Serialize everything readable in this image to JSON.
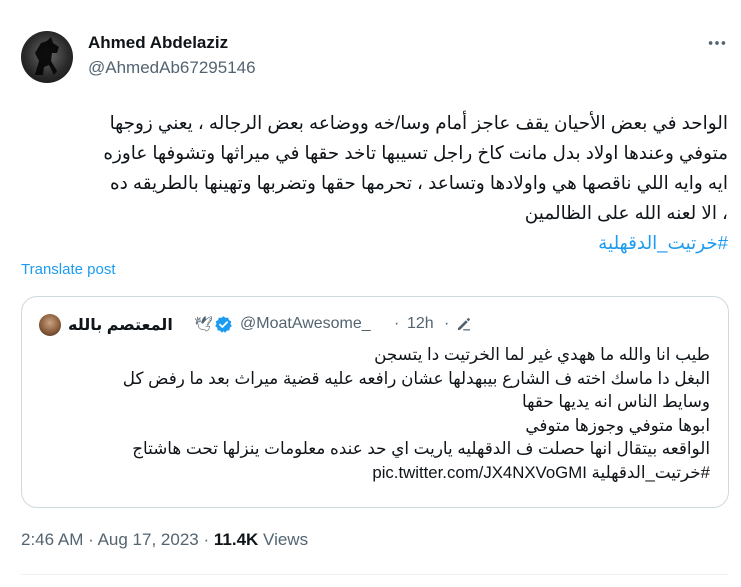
{
  "author": {
    "name": "Ahmed Abdelaziz",
    "handle": "@AhmedAb67295146"
  },
  "tweet": {
    "lines": [
      "الواحد في بعض الأحيان يقف عاجز أمام وسا/خه ووضاعه بعض الرجاله ، يعني زوجها",
      "متوفي وعندها اولاد بدل مانت كاخ راجل تسيبها تاخد حقها في ميراثها وتشوفها عاوزه",
      "ايه وايه اللي ناقصها هي واولادها وتساعد ، تحرمها حقها وتضربها وتهينها بالطريقه ده",
      "، الا لعنه الله على الظالمين"
    ],
    "hashtag": "#خرتيت_الدقهلية",
    "translate_label": "Translate post"
  },
  "quoted": {
    "name": "المعتصم بالله",
    "dove": "🕊",
    "handle": "@MoatAwesome_",
    "dot1": "·",
    "time": "12h",
    "dot2": "·",
    "lines": [
      "طيب انا والله ما ههدي غير لما الخرتيت دا يتسجن",
      "البغل دا ماسك اخته ف الشارع بيبهدلها عشان رافعه عليه قضية ميراث بعد ما رفض كل",
      "وسايط الناس انه يديها حقها",
      "ابوها متوفي وجوزها متوفي",
      "الواقعه بيتقال انها حصلت ف الدقهليه ياريت اي حد عنده معلومات ينزلها تحت هاشتاج",
      "#خرتيت_الدقهلية pic.twitter.com/JX4NXVoGMI"
    ]
  },
  "meta": {
    "time": "2:46 AM",
    "sep1": "·",
    "date": "Aug 17, 2023",
    "sep2": "·",
    "views_count": "11.4K",
    "views_label": "Views"
  },
  "icons": {
    "more": "more-horizontal-icon",
    "verified": "verified-badge-icon",
    "edit": "edit-pencil-icon"
  },
  "colors": {
    "link": "#1d9bf0",
    "secondary": "#536471",
    "border": "#cfd9de",
    "verified": "#1d9bf0"
  }
}
